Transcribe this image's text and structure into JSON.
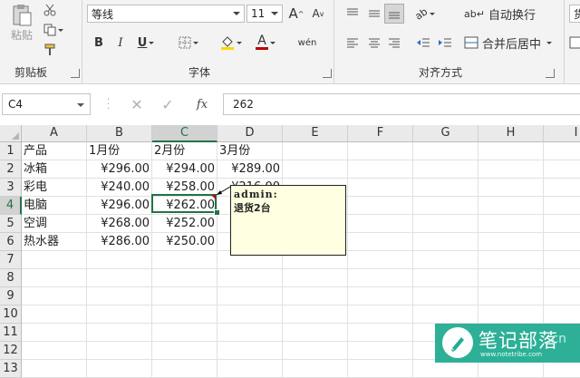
{
  "ribbon": {
    "clipboard": {
      "label": "剪贴板",
      "paste_label": "粘贴"
    },
    "font": {
      "label": "字体",
      "font_name": "等线",
      "font_size": "11",
      "bold": "B",
      "italic": "I",
      "underline": "U",
      "phonetic": "wén",
      "grow": "A",
      "shrink": "A",
      "font_color": "A"
    },
    "alignment": {
      "label": "对齐方式",
      "wrap_text": "自动换行",
      "merge_center": "合并后居中"
    },
    "number": {
      "partial_label": "货"
    }
  },
  "formula_bar": {
    "name_box": "C4",
    "formula": "262",
    "fx": "fx"
  },
  "columns": [
    "A",
    "B",
    "C",
    "D",
    "E",
    "F",
    "G",
    "H",
    "I"
  ],
  "rows": [
    "1",
    "2",
    "3",
    "4",
    "5",
    "6",
    "7",
    "8",
    "9",
    "10",
    "11",
    "12",
    "13"
  ],
  "sheet": {
    "cells": [
      [
        "产品",
        "1月份",
        "2月份",
        "3月份"
      ],
      [
        "冰箱",
        "¥296.00",
        "¥294.00",
        "¥289.00"
      ],
      [
        "彩电",
        "¥240.00",
        "¥258.00",
        "¥216.00"
      ],
      [
        "电脑",
        "¥296.00",
        "¥262.00",
        ""
      ],
      [
        "空调",
        "¥268.00",
        "¥252.00",
        ""
      ],
      [
        "热水器",
        "¥286.00",
        "¥250.00",
        ""
      ]
    ]
  },
  "selection": {
    "column": "C",
    "row": "4"
  },
  "comment": {
    "author": "admin:",
    "text": "退货2台"
  },
  "watermark": {
    "title": "笔记部落",
    "domain": "www.notetribe.com",
    "suffix": ".cn"
  },
  "colors": {
    "excel_green": "#217346",
    "comment_bg": "#ffffe1",
    "watermark": "#22ac91",
    "font_red": "#c00000",
    "highlight_yellow": "#ffd800"
  }
}
